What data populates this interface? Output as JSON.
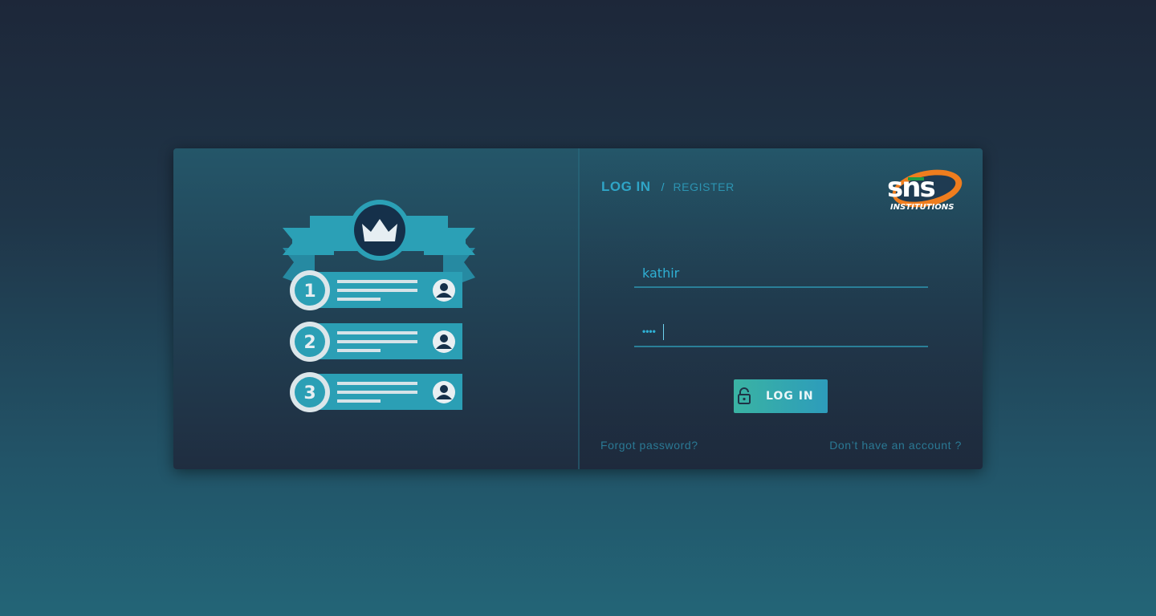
{
  "auth": {
    "tab_login": "LOG IN",
    "tab_separator": "/",
    "tab_register": "REGISTER"
  },
  "logo": {
    "text": "sns",
    "subtext": "INSTITUTIONS"
  },
  "form": {
    "username_value": "kathir",
    "password_masked": "••••",
    "login_button": "LOG IN"
  },
  "links": {
    "forgot_password": "Forgot password?",
    "no_account": "Don’t have an account ?"
  },
  "illustration": {
    "ranks": [
      "1",
      "2",
      "3"
    ],
    "icons": [
      "crown-icon",
      "user-avatar-icon",
      "lock-open-icon"
    ]
  },
  "colors": {
    "accent": "#2fa5c7",
    "ribbon": "#2b9fb5",
    "badge_dark": "#15304a",
    "button_start": "#3ab3a3",
    "button_end": "#2d9cbb"
  }
}
